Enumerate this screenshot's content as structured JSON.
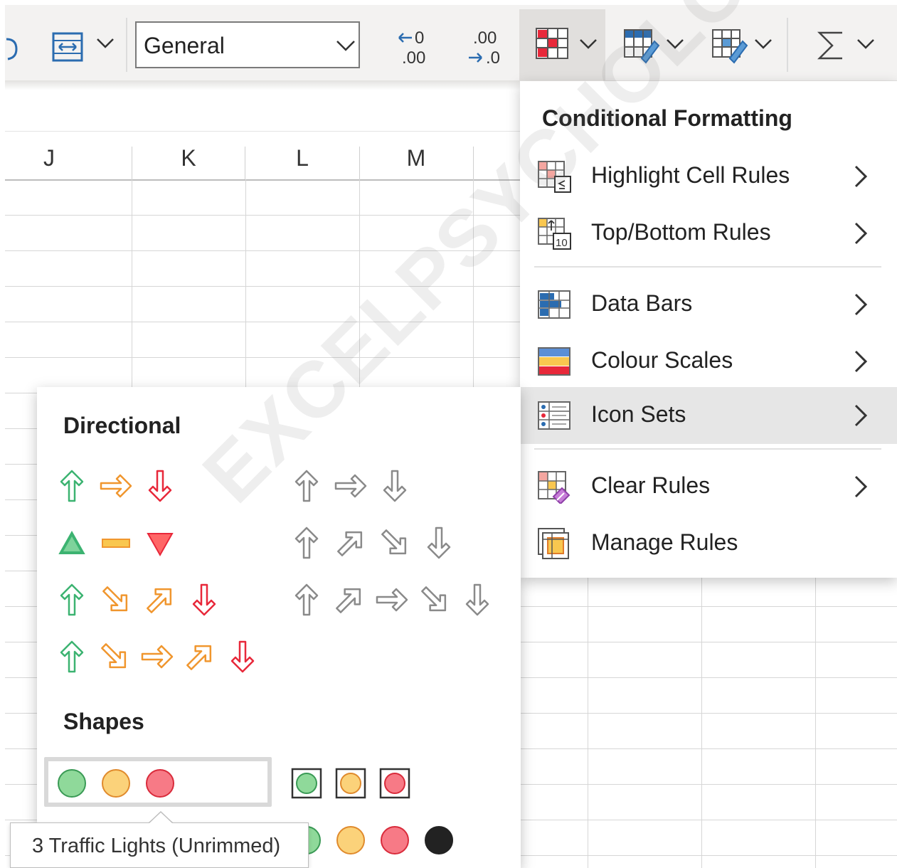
{
  "toolbar": {
    "number_format_value": "General",
    "buttons": [
      {
        "name": "undo-icon"
      },
      {
        "name": "wrap-text-icon"
      },
      {
        "name": "increase-decimal-icon"
      },
      {
        "name": "decrease-decimal-icon"
      },
      {
        "name": "conditional-formatting-icon"
      },
      {
        "name": "format-as-table-icon"
      },
      {
        "name": "cell-styles-icon"
      },
      {
        "name": "autosum-icon"
      }
    ]
  },
  "sheet": {
    "columns": [
      "J",
      "K",
      "L",
      "M"
    ]
  },
  "cf_menu": {
    "title": "Conditional Formatting",
    "items": [
      {
        "label": "Highlight Cell Rules",
        "icon": "highlight-cell-rules-icon",
        "submenu": true
      },
      {
        "label": "Top/Bottom Rules",
        "icon": "top-bottom-rules-icon",
        "submenu": true
      },
      {
        "label": "Data Bars",
        "icon": "data-bars-icon",
        "submenu": true
      },
      {
        "label": "Colour Scales",
        "icon": "colour-scales-icon",
        "submenu": true
      },
      {
        "label": "Icon Sets",
        "icon": "icon-sets-icon",
        "submenu": true,
        "highlighted": true
      },
      {
        "label": "Clear Rules",
        "icon": "clear-rules-icon",
        "submenu": true
      },
      {
        "label": "Manage Rules",
        "icon": "manage-rules-icon",
        "submenu": false
      }
    ]
  },
  "icon_sets": {
    "directional_title": "Directional",
    "shapes_title": "Shapes",
    "colors": {
      "green": "#3cb371",
      "orange": "#f0962e",
      "red": "#e8283a",
      "grey": "#8a8a8a",
      "yellow": "#f9c74f",
      "black": "#222222"
    },
    "tooltip": "3 Traffic Lights (Unrimmed)"
  },
  "watermark": "EXCELPSYCHOLOGY.COM"
}
